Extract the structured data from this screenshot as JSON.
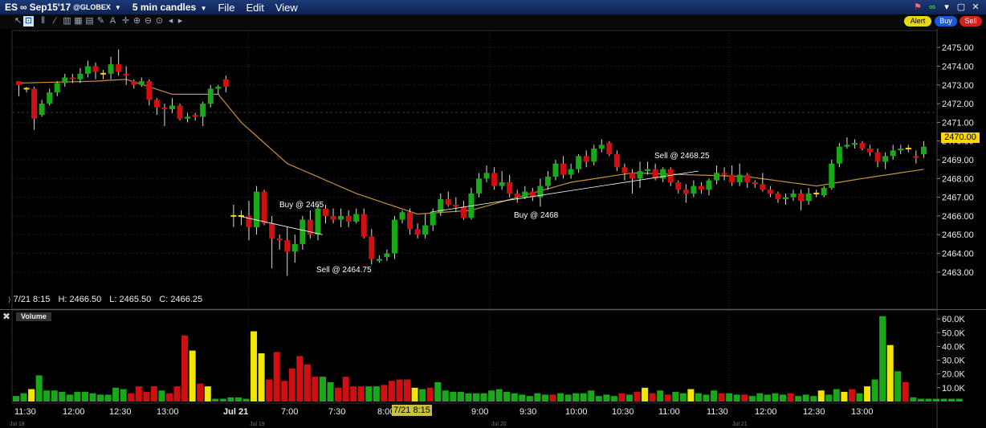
{
  "window": {
    "symbol": "ES",
    "contract": "Sep15'17",
    "exchange": "@GLOBEX",
    "interval": "5 min candles",
    "menus": [
      "File",
      "Edit",
      "View"
    ]
  },
  "toolbar": {
    "alert_label": "Alert",
    "buy_label": "Buy",
    "sell_label": "Sell",
    "accent": "#1f3f7f",
    "buy_color": "#1a5ad8",
    "sell_color": "#d42020",
    "alert_color": "#e8d81a"
  },
  "info_bar": {
    "datetime": "7/21 8:15",
    "high": "H: 2466.50",
    "low": "L: 2465.50",
    "close": "C: 2466.25"
  },
  "volume_panel": {
    "label": "Volume"
  },
  "chart_data": {
    "type": "candlestick",
    "price_axis": {
      "ticks": [
        "2475.00",
        "2474.00",
        "2473.00",
        "2472.00",
        "2471.00",
        "2470.00",
        "2469.00",
        "2468.00",
        "2467.00",
        "2466.00",
        "2465.00",
        "2464.00",
        "2463.00"
      ],
      "range": [
        2462.2,
        2475.5
      ]
    },
    "volume_axis": {
      "ticks": [
        "60.0K",
        "50.0K",
        "40.0K",
        "30.0K",
        "20.0K",
        "10.0K"
      ],
      "range": [
        0,
        63000
      ]
    },
    "time_labels": [
      "11:30",
      "12:00",
      "12:30",
      "13:00",
      "Jul 21",
      "7:00",
      "7:30",
      "8:00",
      "9:00",
      "9:30",
      "10:00",
      "10:30",
      "11:00",
      "11:30",
      "12:00",
      "12:30",
      "13:00"
    ],
    "session_markers": [
      "Jul 18",
      "Jul 19",
      "Jul 20",
      "Jul 21"
    ],
    "current_time_label": "7/21 8:15",
    "last_price": "2470.00",
    "colors": {
      "up": "#18a818",
      "down": "#d01010",
      "volume_neutral": "#f2e500",
      "ma": "#c8903a"
    },
    "annotations": [
      {
        "text": "Buy @ 2465",
        "price": 2466.1
      },
      {
        "text": "Sell @ 2464.75",
        "price": 2464.2
      },
      {
        "text": "Buy @ 2468",
        "price": 2466.3
      },
      {
        "text": "Sell @ 2468.25",
        "price": 2469.3
      }
    ],
    "candles": [
      [
        2473.2,
        2473.0,
        2473.2,
        2472.4
      ],
      [
        2472.8,
        2472.8,
        2472.9,
        2472.6
      ],
      [
        2472.8,
        2471.2,
        2472.9,
        2470.6
      ],
      [
        2471.4,
        2472.0,
        2472.2,
        2471.3
      ],
      [
        2472.0,
        2472.6,
        2472.8,
        2471.9
      ],
      [
        2472.6,
        2473.1,
        2473.2,
        2472.4
      ],
      [
        2473.1,
        2473.4,
        2473.6,
        2472.9
      ],
      [
        2473.4,
        2473.3,
        2473.6,
        2473.1
      ],
      [
        2473.3,
        2473.6,
        2473.9,
        2473.1
      ],
      [
        2473.6,
        2474.0,
        2474.3,
        2473.4
      ],
      [
        2474.0,
        2473.7,
        2474.2,
        2473.3
      ],
      [
        2473.6,
        2473.6,
        2473.8,
        2473.3
      ],
      [
        2473.6,
        2474.1,
        2474.5,
        2473.3
      ],
      [
        2474.1,
        2473.7,
        2474.9,
        2473.5
      ],
      [
        2473.6,
        2473.5,
        2474.0,
        2473.0
      ],
      [
        2473.2,
        2473.0,
        2473.3,
        2472.8
      ],
      [
        2473.0,
        2473.2,
        2473.4,
        2472.9
      ],
      [
        2473.2,
        2472.2,
        2473.3,
        2471.9
      ],
      [
        2472.2,
        2471.8,
        2472.3,
        2471.4
      ],
      [
        2471.8,
        2471.7,
        2472.0,
        2470.8
      ],
      [
        2471.7,
        2471.9,
        2472.3,
        2471.5
      ],
      [
        2471.9,
        2471.2,
        2472.0,
        2471.1
      ],
      [
        2471.2,
        2471.3,
        2471.5,
        2471.0
      ],
      [
        2471.4,
        2471.3,
        2471.5,
        2471.1
      ],
      [
        2471.3,
        2472.0,
        2472.1,
        2470.8
      ],
      [
        2472.0,
        2472.8,
        2473.0,
        2471.8
      ],
      [
        2472.8,
        2472.9,
        2473.0,
        2472.5
      ],
      [
        2473.3,
        2472.9,
        2473.5,
        2472.6
      ],
      [
        2466.0,
        2466.0,
        2466.6,
        2465.4
      ],
      [
        2466.0,
        2466.0,
        2466.3,
        2465.5
      ],
      [
        2466.0,
        2465.4,
        2466.8,
        2464.7
      ],
      [
        2465.4,
        2467.3,
        2467.6,
        2465.0
      ],
      [
        2467.3,
        2465.6,
        2467.4,
        2465.5
      ],
      [
        2465.6,
        2464.8,
        2466.0,
        2463.2
      ],
      [
        2464.8,
        2464.7,
        2465.0,
        2464.2
      ],
      [
        2464.7,
        2464.1,
        2465.4,
        2462.8
      ],
      [
        2464.1,
        2464.5,
        2465.0,
        2463.5
      ],
      [
        2464.5,
        2465.8,
        2466.0,
        2464.2
      ],
      [
        2465.8,
        2465.0,
        2466.3,
        2464.8
      ],
      [
        2465.0,
        2466.4,
        2466.6,
        2464.7
      ],
      [
        2466.4,
        2466.0,
        2466.6,
        2465.6
      ],
      [
        2466.0,
        2465.8,
        2466.4,
        2465.6
      ],
      [
        2465.8,
        2466.0,
        2466.4,
        2465.4
      ],
      [
        2466.0,
        2465.7,
        2466.3,
        2465.4
      ],
      [
        2465.7,
        2466.1,
        2466.4,
        2465.6
      ],
      [
        2466.1,
        2464.9,
        2466.4,
        2464.8
      ],
      [
        2464.9,
        2463.7,
        2465.3,
        2463.4
      ],
      [
        2463.6,
        2463.7,
        2463.9,
        2463.5
      ],
      [
        2463.8,
        2464.0,
        2464.2,
        2463.6
      ],
      [
        2464.0,
        2465.8,
        2466.0,
        2463.7
      ],
      [
        2465.8,
        2466.2,
        2466.3,
        2465.6
      ],
      [
        2466.2,
        2465.3,
        2466.4,
        2465.0
      ],
      [
        2465.3,
        2465.0,
        2465.6,
        2464.8
      ],
      [
        2465.0,
        2465.5,
        2466.1,
        2464.8
      ],
      [
        2465.5,
        2466.2,
        2466.4,
        2465.2
      ],
      [
        2466.2,
        2466.9,
        2467.2,
        2466.0
      ],
      [
        2466.9,
        2466.6,
        2467.3,
        2466.5
      ],
      [
        2466.6,
        2466.5,
        2467.0,
        2466.2
      ],
      [
        2466.5,
        2465.9,
        2466.8,
        2465.8
      ],
      [
        2465.9,
        2467.2,
        2467.5,
        2465.8
      ],
      [
        2467.2,
        2468.0,
        2468.3,
        2467.0
      ],
      [
        2468.0,
        2468.3,
        2468.7,
        2467.8
      ],
      [
        2468.3,
        2467.6,
        2468.6,
        2467.4
      ],
      [
        2467.6,
        2467.8,
        2468.4,
        2467.4
      ],
      [
        2467.8,
        2467.2,
        2468.2,
        2467.0
      ],
      [
        2467.2,
        2467.0,
        2467.4,
        2466.7
      ],
      [
        2467.0,
        2467.3,
        2467.6,
        2466.9
      ],
      [
        2467.3,
        2467.0,
        2467.5,
        2466.8
      ],
      [
        2467.0,
        2467.6,
        2468.0,
        2466.5
      ],
      [
        2467.6,
        2468.1,
        2468.4,
        2467.4
      ],
      [
        2468.1,
        2468.8,
        2469.0,
        2467.9
      ],
      [
        2468.8,
        2468.2,
        2469.2,
        2468.0
      ],
      [
        2468.2,
        2468.5,
        2468.8,
        2468.0
      ],
      [
        2468.5,
        2469.2,
        2469.3,
        2468.3
      ],
      [
        2469.2,
        2468.9,
        2469.5,
        2468.6
      ],
      [
        2468.9,
        2469.6,
        2469.8,
        2468.7
      ],
      [
        2469.6,
        2469.8,
        2470.1,
        2469.4
      ],
      [
        2469.9,
        2469.3,
        2470.0,
        2469.2
      ],
      [
        2469.3,
        2468.6,
        2469.5,
        2468.4
      ],
      [
        2468.6,
        2468.3,
        2468.8,
        2467.9
      ],
      [
        2468.3,
        2468.0,
        2468.5,
        2467.2
      ],
      [
        2468.0,
        2468.4,
        2468.9,
        2467.5
      ],
      [
        2468.4,
        2468.5,
        2468.9,
        2468.2
      ],
      [
        2468.5,
        2468.0,
        2468.8,
        2467.9
      ],
      [
        2468.0,
        2468.5,
        2468.6,
        2467.8
      ],
      [
        2468.5,
        2467.8,
        2468.6,
        2467.6
      ],
      [
        2467.8,
        2467.4,
        2467.9,
        2467.2
      ],
      [
        2467.4,
        2467.2,
        2467.7,
        2466.7
      ],
      [
        2467.2,
        2467.6,
        2467.9,
        2467.0
      ],
      [
        2467.6,
        2467.4,
        2467.8,
        2467.2
      ],
      [
        2467.4,
        2467.9,
        2468.0,
        2467.1
      ],
      [
        2467.9,
        2468.3,
        2468.7,
        2467.7
      ],
      [
        2468.3,
        2468.2,
        2468.6,
        2467.9
      ],
      [
        2468.2,
        2467.8,
        2468.7,
        2467.6
      ],
      [
        2467.8,
        2468.2,
        2468.8,
        2467.6
      ],
      [
        2468.2,
        2467.8,
        2468.3,
        2467.5
      ],
      [
        2467.8,
        2467.7,
        2467.9,
        2467.5
      ],
      [
        2467.7,
        2467.4,
        2468.3,
        2467.3
      ],
      [
        2467.4,
        2467.2,
        2467.6,
        2467.0
      ],
      [
        2467.2,
        2466.9,
        2467.3,
        2466.7
      ],
      [
        2466.9,
        2467.0,
        2467.2,
        2466.6
      ],
      [
        2467.0,
        2467.2,
        2467.4,
        2466.8
      ],
      [
        2467.2,
        2466.8,
        2467.4,
        2466.3
      ],
      [
        2466.8,
        2467.2,
        2467.5,
        2466.6
      ],
      [
        2467.2,
        2467.2,
        2467.4,
        2467.0
      ],
      [
        2467.1,
        2467.5,
        2467.6,
        2467.0
      ],
      [
        2467.5,
        2468.8,
        2469.0,
        2467.4
      ],
      [
        2468.8,
        2469.7,
        2469.9,
        2468.6
      ],
      [
        2469.7,
        2469.8,
        2470.2,
        2469.6
      ],
      [
        2469.8,
        2469.9,
        2470.1,
        2469.6
      ],
      [
        2469.9,
        2469.6,
        2470.0,
        2469.5
      ],
      [
        2469.6,
        2469.4,
        2469.8,
        2469.2
      ],
      [
        2469.4,
        2468.9,
        2469.6,
        2468.6
      ],
      [
        2468.9,
        2469.2,
        2469.4,
        2468.5
      ],
      [
        2469.2,
        2469.5,
        2469.8,
        2469.0
      ],
      [
        2469.5,
        2469.6,
        2469.8,
        2469.3
      ],
      [
        2469.6,
        2469.6,
        2469.8,
        2469.4
      ],
      [
        2469.2,
        2469.1,
        2469.5,
        2468.8
      ],
      [
        2469.3,
        2469.7,
        2470.0,
        2469.1
      ]
    ],
    "ma_anchors": [
      [
        0,
        2473.1
      ],
      [
        10,
        2473.2
      ],
      [
        14,
        2473.3
      ],
      [
        20,
        2472.5
      ],
      [
        26,
        2472.5
      ],
      [
        29,
        2471.0
      ],
      [
        35,
        2468.8
      ],
      [
        44,
        2467.2
      ],
      [
        52,
        2466.1
      ],
      [
        59,
        2466.3
      ],
      [
        72,
        2467.8
      ],
      [
        80,
        2468.3
      ],
      [
        95,
        2468.1
      ],
      [
        104,
        2467.6
      ],
      [
        110,
        2468.0
      ],
      [
        123,
        2468.8
      ]
    ],
    "volume": [
      [
        4,
        "g"
      ],
      [
        6,
        "g"
      ],
      [
        9,
        "y"
      ],
      [
        19,
        "g"
      ],
      [
        8,
        "g"
      ],
      [
        8,
        "g"
      ],
      [
        7,
        "g"
      ],
      [
        5,
        "g"
      ],
      [
        7,
        "g"
      ],
      [
        7,
        "g"
      ],
      [
        6,
        "g"
      ],
      [
        5,
        "g"
      ],
      [
        5,
        "g"
      ],
      [
        10,
        "g"
      ],
      [
        9,
        "g"
      ],
      [
        6,
        "r"
      ],
      [
        11,
        "r"
      ],
      [
        7,
        "r"
      ],
      [
        11,
        "r"
      ],
      [
        8,
        "g"
      ],
      [
        6,
        "r"
      ],
      [
        11,
        "r"
      ],
      [
        48,
        "r"
      ],
      [
        37,
        "y"
      ],
      [
        13,
        "r"
      ],
      [
        11,
        "y"
      ],
      [
        2,
        "g"
      ],
      [
        2,
        "g"
      ],
      [
        3,
        "g"
      ],
      [
        3,
        "g"
      ],
      [
        2,
        "g"
      ],
      [
        51,
        "y"
      ],
      [
        35,
        "y"
      ],
      [
        16,
        "r"
      ],
      [
        36,
        "r"
      ],
      [
        15,
        "r"
      ],
      [
        24,
        "r"
      ],
      [
        33,
        "r"
      ],
      [
        27,
        "r"
      ],
      [
        18,
        "r"
      ],
      [
        18,
        "g"
      ],
      [
        14,
        "g"
      ],
      [
        10,
        "r"
      ],
      [
        18,
        "r"
      ],
      [
        11,
        "r"
      ],
      [
        11,
        "r"
      ],
      [
        11,
        "g"
      ],
      [
        11,
        "g"
      ],
      [
        12,
        "r"
      ],
      [
        15,
        "r"
      ],
      [
        16,
        "r"
      ],
      [
        16,
        "r"
      ],
      [
        10,
        "y"
      ],
      [
        9,
        "g"
      ],
      [
        10,
        "r"
      ],
      [
        14,
        "g"
      ],
      [
        8,
        "g"
      ],
      [
        7,
        "g"
      ],
      [
        7,
        "g"
      ],
      [
        6,
        "g"
      ],
      [
        6,
        "g"
      ],
      [
        6,
        "g"
      ],
      [
        8,
        "g"
      ],
      [
        9,
        "g"
      ],
      [
        7,
        "g"
      ],
      [
        6,
        "g"
      ],
      [
        5,
        "g"
      ],
      [
        4,
        "g"
      ],
      [
        6,
        "g"
      ],
      [
        5,
        "g"
      ],
      [
        5,
        "r"
      ],
      [
        6,
        "g"
      ],
      [
        5,
        "g"
      ],
      [
        6,
        "g"
      ],
      [
        6,
        "g"
      ],
      [
        8,
        "g"
      ],
      [
        4,
        "g"
      ],
      [
        5,
        "g"
      ],
      [
        4,
        "g"
      ],
      [
        6,
        "r"
      ],
      [
        5,
        "g"
      ],
      [
        7,
        "r"
      ],
      [
        10,
        "y"
      ],
      [
        6,
        "r"
      ],
      [
        8,
        "g"
      ],
      [
        5,
        "r"
      ],
      [
        7,
        "g"
      ],
      [
        6,
        "g"
      ],
      [
        9,
        "y"
      ],
      [
        6,
        "g"
      ],
      [
        5,
        "g"
      ],
      [
        8,
        "g"
      ],
      [
        6,
        "r"
      ],
      [
        6,
        "g"
      ],
      [
        5,
        "g"
      ],
      [
        5,
        "r"
      ],
      [
        4,
        "g"
      ],
      [
        6,
        "g"
      ],
      [
        5,
        "g"
      ],
      [
        6,
        "g"
      ],
      [
        5,
        "g"
      ],
      [
        6,
        "r"
      ],
      [
        4,
        "g"
      ],
      [
        5,
        "g"
      ],
      [
        4,
        "g"
      ],
      [
        8,
        "y"
      ],
      [
        5,
        "g"
      ],
      [
        9,
        "g"
      ],
      [
        7,
        "y"
      ],
      [
        9,
        "r"
      ],
      [
        6,
        "g"
      ],
      [
        11,
        "y"
      ],
      [
        16,
        "g"
      ],
      [
        62,
        "g"
      ],
      [
        41,
        "y"
      ],
      [
        22,
        "g"
      ],
      [
        14,
        "r"
      ],
      [
        3,
        "g"
      ],
      [
        2,
        "g"
      ],
      [
        2,
        "g"
      ],
      [
        2,
        "g"
      ],
      [
        2,
        "g"
      ],
      [
        2,
        "g"
      ],
      [
        2,
        "g"
      ]
    ]
  }
}
